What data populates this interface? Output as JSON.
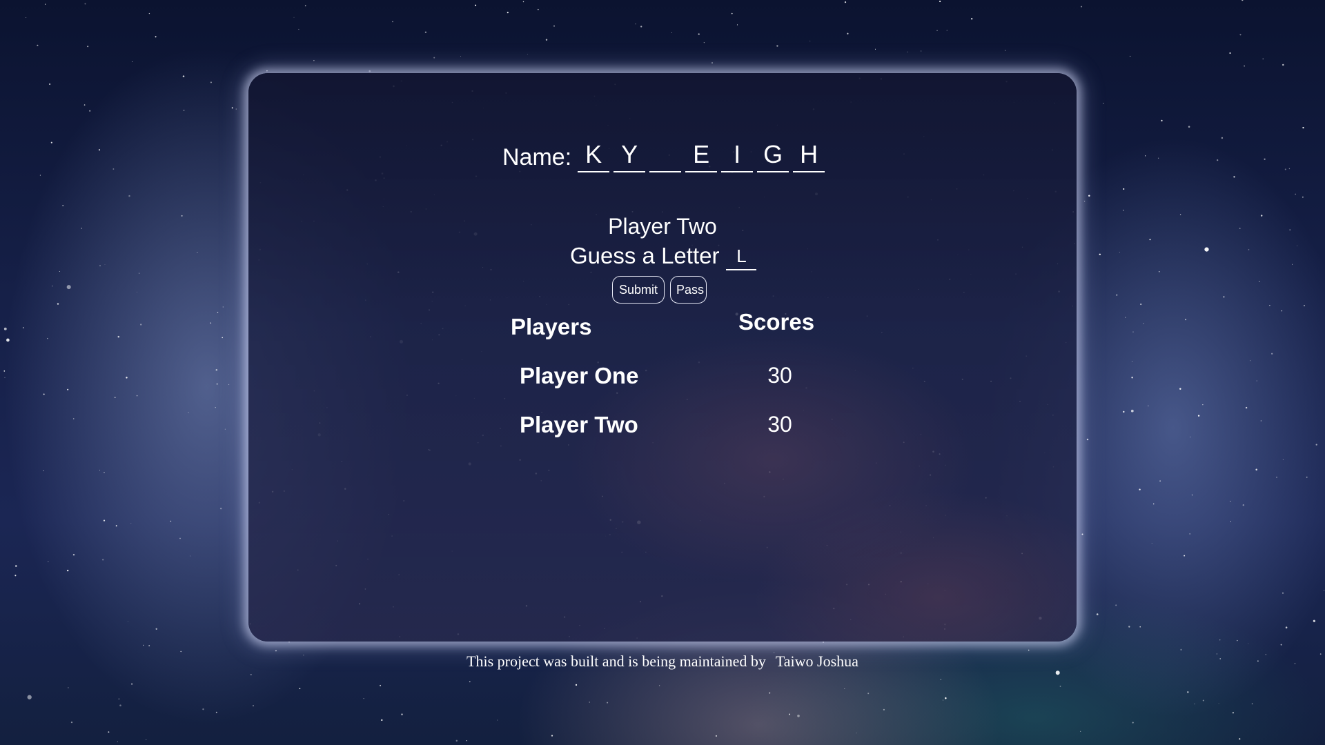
{
  "game": {
    "name_label": "Name:",
    "slots": [
      "K",
      "Y",
      "",
      "E",
      "I",
      "G",
      "H"
    ],
    "current_player": "Player Two",
    "guess_label": "Guess a Letter",
    "guess_value": "L",
    "submit_label": "Submit",
    "pass_label": "Pass"
  },
  "scoreboard": {
    "players_header": "Players",
    "scores_header": "Scores",
    "rows": [
      {
        "player": "Player One",
        "score": "30"
      },
      {
        "player": "Player Two",
        "score": "30"
      }
    ]
  },
  "footer": {
    "text": "This project was built and is being maintained by",
    "author": "Taiwo Joshua"
  },
  "colors": {
    "text": "#ffffff",
    "panel_glow": "#dde1ff"
  }
}
